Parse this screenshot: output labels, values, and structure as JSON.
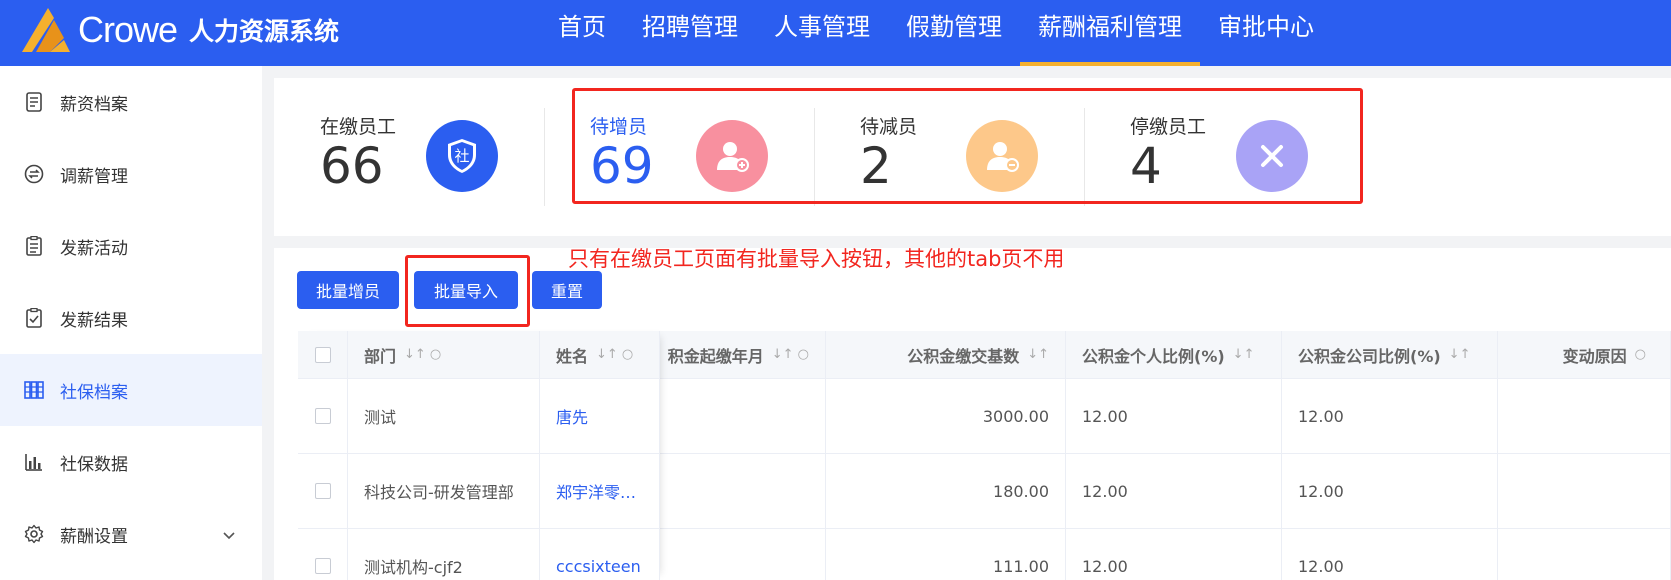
{
  "header": {
    "brand": "Crowe",
    "system_name": "人力资源系统",
    "nav": [
      "首页",
      "招聘管理",
      "人事管理",
      "假勤管理",
      "薪酬福利管理",
      "审批中心"
    ],
    "active_nav": "薪酬福利管理",
    "accent_color": "#2b5ef0",
    "active_underline_color": "#f5b02e"
  },
  "sidebar": {
    "items": [
      {
        "label": "薪资档案",
        "icon": "file-icon"
      },
      {
        "label": "调薪管理",
        "icon": "exchange-icon"
      },
      {
        "label": "发薪活动",
        "icon": "clipboard-icon"
      },
      {
        "label": "发薪结果",
        "icon": "clipboard-check-icon"
      },
      {
        "label": "社保档案",
        "icon": "columns-icon",
        "active": true
      },
      {
        "label": "社保数据",
        "icon": "bar-chart-icon"
      },
      {
        "label": "薪酬设置",
        "icon": "gear-icon",
        "expandable": true
      }
    ]
  },
  "stats": [
    {
      "label": "在缴员工",
      "value": "66",
      "icon": "shield-icon",
      "icon_text": "社",
      "color": "#2b5ef0"
    },
    {
      "label": "待增员",
      "value": "69",
      "icon": "user-add-icon",
      "color": "#f8909f",
      "active": true
    },
    {
      "label": "待减员",
      "value": "2",
      "icon": "user-minus-icon",
      "color": "#fdc88a"
    },
    {
      "label": "停缴员工",
      "value": "4",
      "icon": "close-icon",
      "color": "#a9a3f6"
    }
  ],
  "annotation": "只有在缴员工页面有批量导入按钮，其他的tab页不用",
  "toolbar": {
    "add_label": "批量增员",
    "import_label": "批量导入",
    "reset_label": "重置"
  },
  "table": {
    "columns": [
      "部门",
      "姓名",
      "积金起缴年月",
      "公积金缴交基数",
      "公积金个人比例(%)",
      "公积金公司比例(%)",
      "变动原因"
    ],
    "rows": [
      {
        "dept": "测试",
        "name": "唐先",
        "month": "",
        "base": "3000.00",
        "personal": "12.00",
        "company": "12.00",
        "reason": ""
      },
      {
        "dept": "科技公司-研发管理部",
        "name": "郑宇洋零…",
        "month": "",
        "base": "180.00",
        "personal": "12.00",
        "company": "12.00",
        "reason": ""
      },
      {
        "dept": "测试机构-cjf2",
        "name": "cccsixteen",
        "month": "",
        "base": "111.00",
        "personal": "12.00",
        "company": "12.00",
        "reason": ""
      }
    ]
  }
}
